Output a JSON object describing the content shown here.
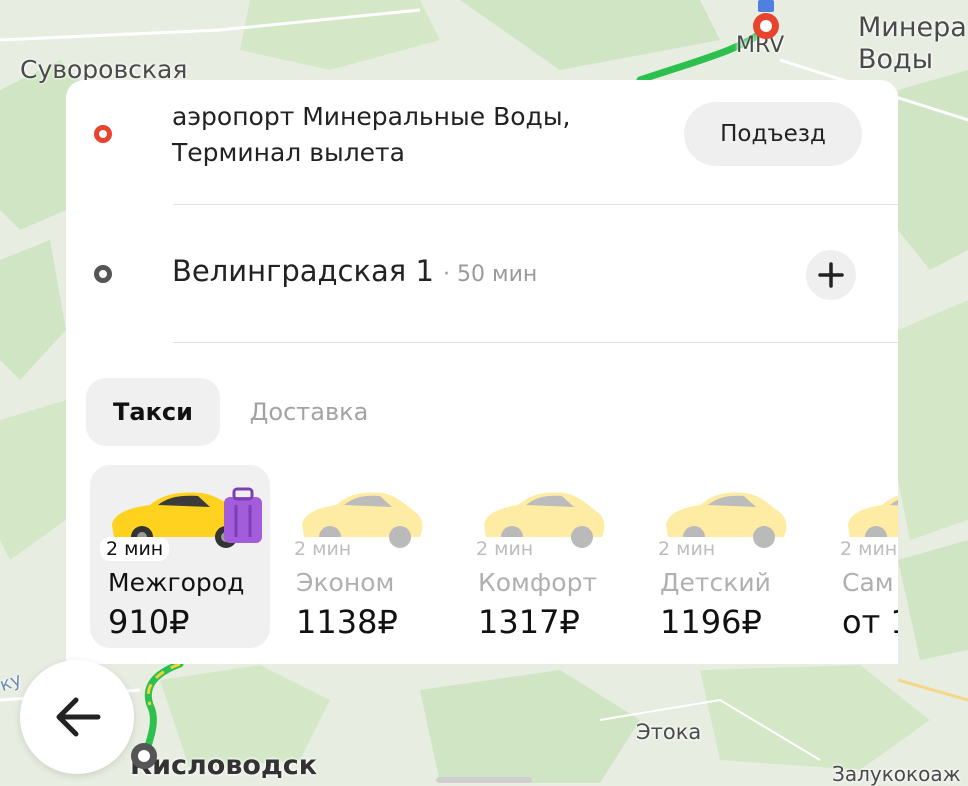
{
  "map": {
    "labels": {
      "suvorovskaya": "Суворовская",
      "mineralnye_line1": "Минера",
      "mineralnye_line2": "Воды",
      "airport_code": "MRV",
      "etoka": "Этока",
      "kislovodsk": "Кисловодск",
      "zalukokoazhe": "Залукокоаж",
      "edge_fragment": "ку"
    }
  },
  "route": {
    "from": {
      "line1": "аэропорт Минеральные Воды,",
      "line2": "Терминал вылета",
      "action_label": "Подъезд"
    },
    "to": {
      "address": "Велинградская 1",
      "duration": "· 50 мин",
      "add_icon": "plus-icon"
    }
  },
  "service_tabs": [
    {
      "label": "Такси",
      "active": true
    },
    {
      "label": "Доставка",
      "active": false
    }
  ],
  "tariffs": [
    {
      "eta": "2 мин",
      "name": "Межгород",
      "price": "910₽",
      "selected": true
    },
    {
      "eta": "2 мин",
      "name": "Эконом",
      "price": "1138₽",
      "selected": false
    },
    {
      "eta": "2 мин",
      "name": "Комфорт",
      "price": "1317₽",
      "selected": false
    },
    {
      "eta": "2 мин",
      "name": "Детский",
      "price": "1196₽",
      "selected": false
    },
    {
      "eta": "2 мин",
      "name": "Сам",
      "price": "от 1",
      "selected": false
    }
  ],
  "back_button_icon": "arrow-left-icon",
  "colors": {
    "origin_marker": "#e8432e",
    "route_line": "#2ec04f",
    "taxi_yellow": "#ffd21f",
    "luggage_purple": "#a35ddc"
  }
}
